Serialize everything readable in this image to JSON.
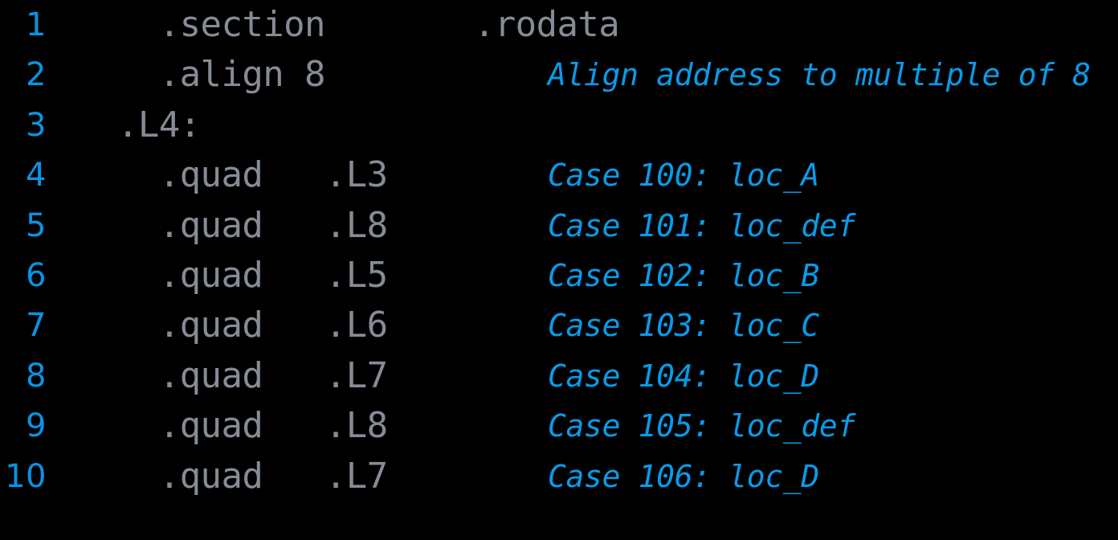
{
  "window": {
    "title": "Assembly Jump Table Listing",
    "background_color": "#000000"
  },
  "theme": {
    "background": "#000000",
    "line_number_color": "#0a93e4",
    "code_color": "#868c96",
    "comment_color": "#0a9ae8",
    "line_height_px": 62.4,
    "code_font_size_px": 44,
    "comment_font_size_px": 38,
    "line_number_font_size_px": 40
  },
  "listing": {
    "language": "x86-64 assembly",
    "total_lines": 10,
    "lines": [
      {
        "number": "1",
        "code": "  .section",
        "comment": ""
      },
      {
        "number": "2",
        "code": "  .align 8",
        "comment": "Align address to multiple of 8"
      },
      {
        "number": "3",
        "code": ".L4:",
        "comment": ""
      },
      {
        "number": "4",
        "code": "  .quad   .L3",
        "comment": "Case 100: loc_A"
      },
      {
        "number": "5",
        "code": "  .quad   .L8",
        "comment": "Case 101: loc_def"
      },
      {
        "number": "6",
        "code": "  .quad   .L5",
        "comment": "Case 102: loc_B"
      },
      {
        "number": "7",
        "code": "  .quad   .L6",
        "comment": "Case 103: loc_C"
      },
      {
        "number": "8",
        "code": "  .quad   .L7",
        "comment": "Case 104: loc_D"
      },
      {
        "number": "9",
        "code": "  .quad   .L8",
        "comment": "Case 105: loc_def"
      },
      {
        "number": "10",
        "code": "  .quad   .L7",
        "comment": "Case 106: loc_D"
      }
    ],
    "operand_column_text": {
      "line_1_operand": ".rodata"
    }
  }
}
